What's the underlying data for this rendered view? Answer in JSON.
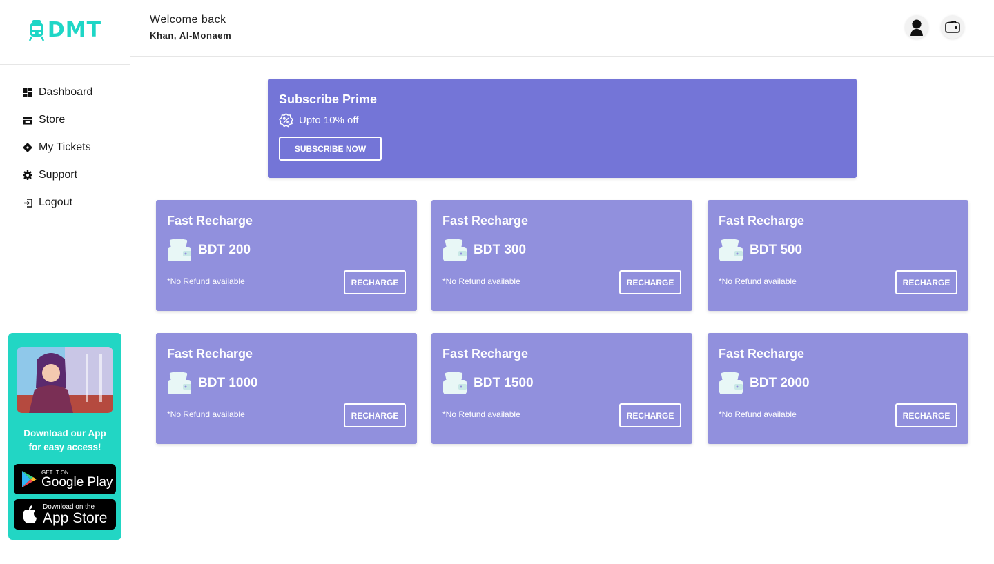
{
  "brand": {
    "logo_text": "DMT",
    "accent": "#1ed6c6"
  },
  "header": {
    "welcome": "Welcome back",
    "username": "Khan, Al-Monaem"
  },
  "nav": [
    {
      "label": "Dashboard",
      "icon": "dashboard-icon"
    },
    {
      "label": "Store",
      "icon": "store-icon"
    },
    {
      "label": "My Tickets",
      "icon": "ticket-icon"
    },
    {
      "label": "Support",
      "icon": "gear-icon"
    },
    {
      "label": "Logout",
      "icon": "logout-icon"
    }
  ],
  "promo": {
    "text_line1": "Download our App",
    "text_line2": "for easy access!",
    "google": {
      "small": "GET IT ON",
      "big": "Google Play"
    },
    "apple": {
      "small": "Download on the",
      "big": "App Store"
    }
  },
  "prime": {
    "title": "Subscribe Prime",
    "subtitle": "Upto 10% off",
    "button": "SUBSCRIBE NOW",
    "color": "#7475d7"
  },
  "cards": [
    {
      "title": "Fast Recharge",
      "amount": "BDT 200",
      "note": "*No Refund available",
      "button": "RECHARGE"
    },
    {
      "title": "Fast Recharge",
      "amount": "BDT 300",
      "note": "*No Refund available",
      "button": "RECHARGE"
    },
    {
      "title": "Fast Recharge",
      "amount": "BDT 500",
      "note": "*No Refund available",
      "button": "RECHARGE"
    },
    {
      "title": "Fast Recharge",
      "amount": "BDT 1000",
      "note": "*No Refund available",
      "button": "RECHARGE"
    },
    {
      "title": "Fast Recharge",
      "amount": "BDT 1500",
      "note": "*No Refund available",
      "button": "RECHARGE"
    },
    {
      "title": "Fast Recharge",
      "amount": "BDT 2000",
      "note": "*No Refund available",
      "button": "RECHARGE"
    }
  ],
  "card_color": "#9190dd"
}
